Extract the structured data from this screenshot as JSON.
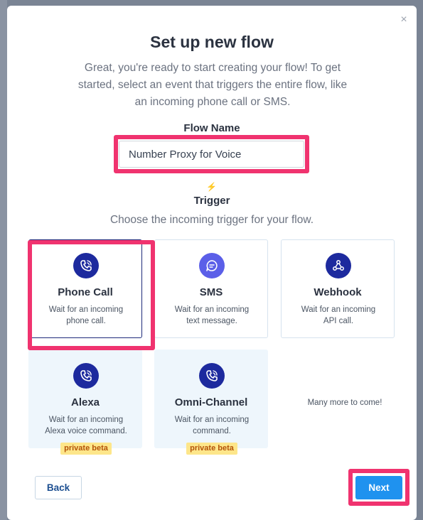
{
  "modal": {
    "title": "Set up new flow",
    "intro": "Great, you're ready to start creating your flow! To get started, select an event that triggers the entire flow, like an incoming phone call or SMS.",
    "close_icon": "×"
  },
  "flow_name": {
    "label": "Flow Name",
    "value": "Number Proxy for Voice"
  },
  "trigger": {
    "icon": "lightning-bolt-icon",
    "label": "Trigger",
    "description": "Choose the incoming trigger for your flow."
  },
  "cards": [
    {
      "name": "Phone Call",
      "description": "Wait for an incoming phone call.",
      "icon": "phone-call-icon",
      "color": "#1d2a9e",
      "selected": true
    },
    {
      "name": "SMS",
      "description": "Wait for an incoming text message.",
      "icon": "chat-bubble-icon",
      "color": "#5b5fe8"
    },
    {
      "name": "Webhook",
      "description": "Wait for an incoming API call.",
      "icon": "webhook-icon",
      "color": "#1d2a9e"
    },
    {
      "name": "Alexa",
      "description": "Wait for an incoming Alexa voice command.",
      "icon": "phone-call-icon",
      "color": "#1d2a9e",
      "badge": "private beta"
    },
    {
      "name": "Omni-Channel",
      "description": "Wait for an incoming command.",
      "icon": "phone-call-icon",
      "color": "#1d2a9e",
      "badge": "private beta"
    }
  ],
  "more_text": "Many more to come!",
  "buttons": {
    "back": "Back",
    "next": "Next"
  },
  "colors": {
    "highlight": "#f0336f",
    "primary": "#1f92ef",
    "icon_dark": "#1d2a9e",
    "icon_light": "#5b5fe8",
    "beta_badge": "#fde68a"
  }
}
